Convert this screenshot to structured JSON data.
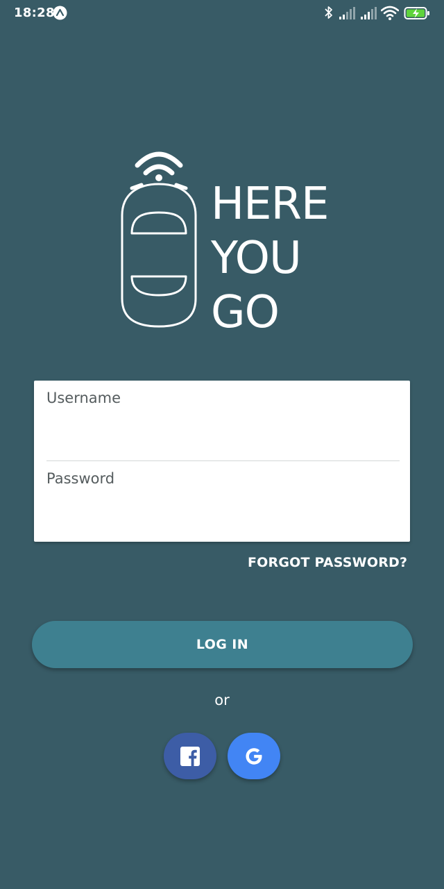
{
  "status_bar": {
    "time": "18:28",
    "icons": [
      "app-notification-icon",
      "bluetooth-icon",
      "signal-icon",
      "signal-icon",
      "wifi-icon",
      "battery-charging-icon"
    ]
  },
  "logo": {
    "line1": "HERE",
    "line2": "YOU",
    "line3": "GO",
    "icon": "car-wifi-icon"
  },
  "form": {
    "username_label": "Username",
    "username_value": "",
    "password_label": "Password",
    "password_value": ""
  },
  "forgot_password": "FORGOT PASSWORD?",
  "login_button": "LOG IN",
  "separator": "or",
  "social": {
    "facebook_icon": "facebook-icon",
    "google_icon": "google-icon"
  },
  "colors": {
    "background": "#385b66",
    "primary_button": "#3e8090",
    "facebook": "#3d5da6",
    "google": "#4285f4"
  }
}
